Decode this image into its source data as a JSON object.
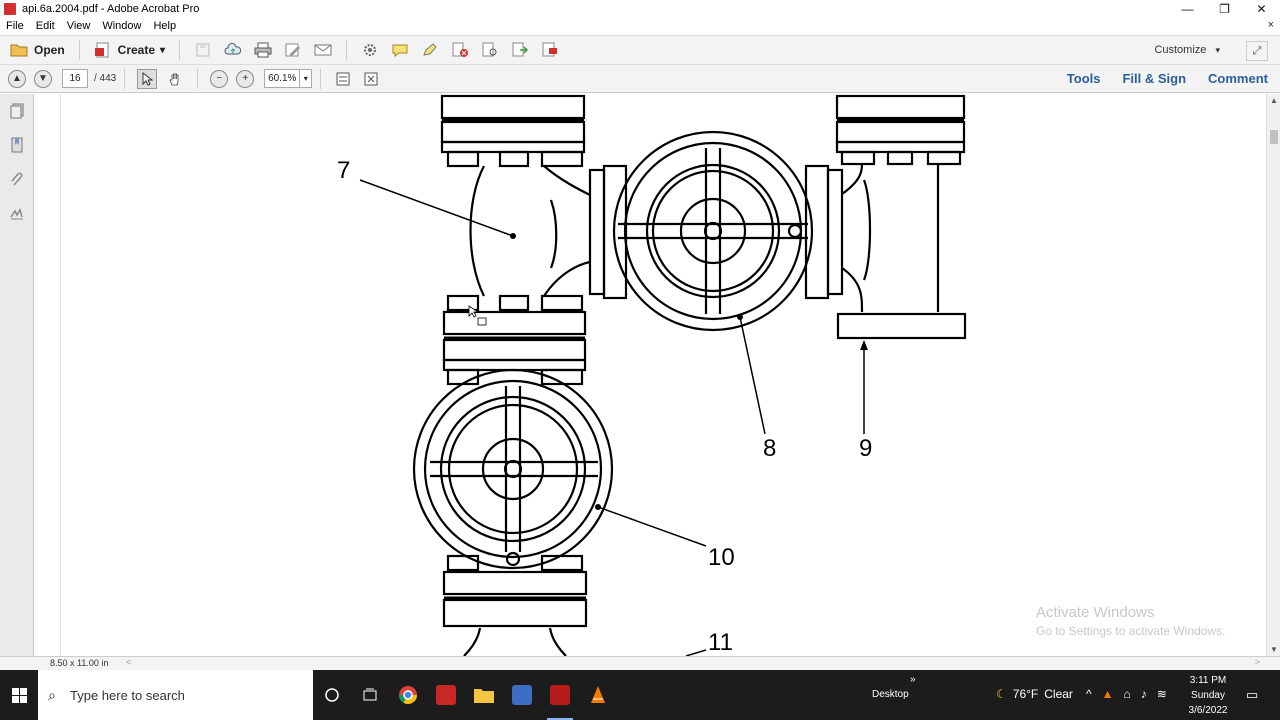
{
  "window": {
    "title": "api.6a.2004.pdf - Adobe Acrobat Pro",
    "minimize": "—",
    "restore": "❐",
    "close": "✕"
  },
  "menu": {
    "items": [
      "File",
      "Edit",
      "View",
      "Window",
      "Help"
    ],
    "close_doc": "×"
  },
  "toolbar1": {
    "open_label": "Open",
    "create_label": "Create",
    "create_arrow": "▾",
    "customize_label": "Customize",
    "customize_arrow": "▾"
  },
  "toolbar2": {
    "current_page": "16",
    "total_pages": "/ 443",
    "zoom": "60.1%",
    "zoom_arrow": "▾",
    "tools_label": "Tools",
    "fill_sign_label": "Fill & Sign",
    "comment_label": "Comment"
  },
  "document": {
    "callouts": [
      "7",
      "8",
      "9",
      "10",
      "11"
    ]
  },
  "statusbar": {
    "page_size": "8.50 x 11.00 in",
    "scroll_left": "<",
    "scroll_right": ">"
  },
  "watermark": {
    "line1": "Activate Windows",
    "line2": "Go to Settings to activate Windows."
  },
  "taskbar": {
    "search_placeholder": "Type here to search",
    "desktop_label": "Desktop",
    "overflow": "»",
    "weather_temp": "76°F",
    "weather_cond": "Clear",
    "time": "3:11 PM",
    "day": "Sunday",
    "date": "3/6/2022"
  },
  "colors": {
    "accent_blue": "#2b5f9e",
    "acrobat_red": "#d32f2f",
    "taskbar_bg": "#1c1c1c"
  }
}
